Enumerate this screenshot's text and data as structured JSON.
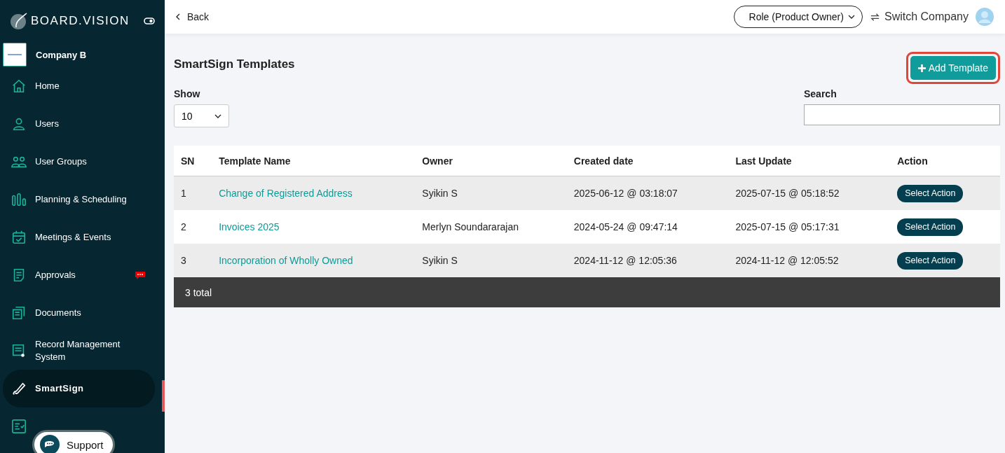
{
  "brand": {
    "name": "BOARD.VISION"
  },
  "company": {
    "name": "Company B"
  },
  "sidebar": {
    "items": [
      {
        "label": "Home",
        "selected": false,
        "badge": false
      },
      {
        "label": "Users",
        "selected": false,
        "badge": false
      },
      {
        "label": "User Groups",
        "selected": false,
        "badge": false
      },
      {
        "label": "Planning & Scheduling",
        "selected": false,
        "badge": false
      },
      {
        "label": "Meetings & Events",
        "selected": false,
        "badge": false
      },
      {
        "label": "Approvals",
        "selected": false,
        "badge": true
      },
      {
        "label": "Documents",
        "selected": false,
        "badge": false
      },
      {
        "label": "Record Management System",
        "selected": false,
        "badge": false
      },
      {
        "label": "SmartSign",
        "selected": true,
        "badge": false
      }
    ]
  },
  "support": {
    "label": "Support"
  },
  "header": {
    "back": "Back",
    "role": "Role (Product Owner)",
    "switch": "Switch Company"
  },
  "page": {
    "title": "SmartSign Templates",
    "add_button": "Add Template",
    "show_label": "Show",
    "show_value": "10",
    "search_label": "Search"
  },
  "table": {
    "columns": [
      "SN",
      "Template Name",
      "Owner",
      "Created date",
      "Last Update",
      "Action"
    ],
    "rows": [
      {
        "sn": "1",
        "name": "Change of Registered Address",
        "owner": "Syikin S",
        "created": "2025-06-12 @ 03:18:07",
        "updated": "2025-07-15 @ 05:18:52",
        "action": "Select Action"
      },
      {
        "sn": "2",
        "name": "Invoices 2025",
        "owner": "Merlyn Soundararajan",
        "created": "2024-05-24 @ 09:47:14",
        "updated": "2025-07-15 @ 05:17:31",
        "action": "Select Action"
      },
      {
        "sn": "3",
        "name": "Incorporation of Wholly Owned",
        "owner": "Syikin S",
        "created": "2024-11-12 @ 12:05:36",
        "updated": "2024-11-12 @ 12:05:52",
        "action": "Select Action"
      }
    ],
    "footer": "3 total"
  }
}
